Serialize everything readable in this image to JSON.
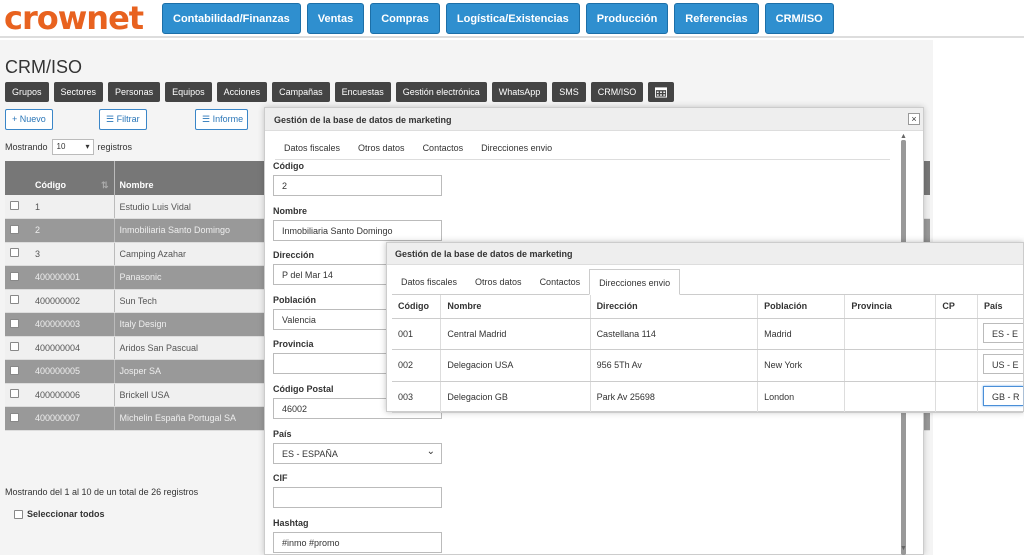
{
  "logo": "crownet",
  "topnav": [
    "Contabilidad/Finanzas",
    "Ventas",
    "Compras",
    "Logística/Existencias",
    "Producción",
    "Referencias",
    "CRM/ISO"
  ],
  "page_title": "CRM/ISO",
  "subnav": [
    "Grupos",
    "Sectores",
    "Personas",
    "Equipos",
    "Acciones",
    "Campañas",
    "Encuestas",
    "Gestión electrónica",
    "WhatsApp",
    "SMS",
    "CRM/ISO"
  ],
  "toolbar": {
    "nuevo": "+ Nuevo",
    "filtrar": "Filtrar",
    "informe": "Informe"
  },
  "show": {
    "prefix": "Mostrando",
    "value": "10",
    "suffix": "registros"
  },
  "list": {
    "headers": [
      "Código",
      "Nombre"
    ],
    "rows": [
      {
        "codigo": "1",
        "nombre": "Estudio Luis Vidal"
      },
      {
        "codigo": "2",
        "nombre": "Inmobiliaria Santo Domingo"
      },
      {
        "codigo": "3",
        "nombre": "Camping Azahar"
      },
      {
        "codigo": "400000001",
        "nombre": "Panasonic"
      },
      {
        "codigo": "400000002",
        "nombre": "Sun Tech"
      },
      {
        "codigo": "400000003",
        "nombre": "Italy Design"
      },
      {
        "codigo": "400000004",
        "nombre": "Aridos San Pascual"
      },
      {
        "codigo": "400000005",
        "nombre": "Josper SA"
      },
      {
        "codigo": "400000006",
        "nombre": "Brickell USA"
      },
      {
        "codigo": "400000007",
        "nombre": "Michelin España Portugal SA"
      }
    ]
  },
  "footer": {
    "summary": "Mostrando del 1 al 10 de un total de 26 registros",
    "select_all": "Seleccionar todos"
  },
  "modal1": {
    "title": "Gestión de la base de datos de marketing",
    "tabs": [
      "Datos fiscales",
      "Otros datos",
      "Contactos",
      "Direcciones envio"
    ],
    "fields": {
      "codigo": {
        "label": "Código",
        "value": "2"
      },
      "nombre": {
        "label": "Nombre",
        "value": "Inmobiliaria Santo Domingo"
      },
      "direccion": {
        "label": "Dirección",
        "value": "P del Mar 14"
      },
      "poblacion": {
        "label": "Población",
        "value": "Valencia"
      },
      "provincia": {
        "label": "Provincia",
        "value": ""
      },
      "cp": {
        "label": "Código Postal",
        "value": "46002"
      },
      "pais": {
        "label": "País",
        "value": "ES - ESPAÑA"
      },
      "cif": {
        "label": "CIF",
        "value": ""
      },
      "hashtag": {
        "label": "Hashtag",
        "value": "#inmo #promo"
      }
    }
  },
  "modal2": {
    "title": "Gestión de la base de datos de marketing",
    "tabs": [
      "Datos fiscales",
      "Otros datos",
      "Contactos",
      "Direcciones envio"
    ],
    "headers": [
      "Código",
      "Nombre",
      "Dirección",
      "Población",
      "Provincia",
      "CP",
      "País"
    ],
    "rows": [
      {
        "codigo": "001",
        "nombre": "Central Madrid",
        "direccion": "Castellana 114",
        "poblacion": "Madrid",
        "provincia": "",
        "cp": "",
        "pais": "ES - E"
      },
      {
        "codigo": "002",
        "nombre": "Delegacion USA",
        "direccion": "956 5Th Av",
        "poblacion": "New York",
        "provincia": "",
        "cp": "",
        "pais": "US - E"
      },
      {
        "codigo": "003",
        "nombre": "Delegacion GB",
        "direccion": "Park Av 25698",
        "poblacion": "London",
        "provincia": "",
        "cp": "",
        "pais": "GB - R"
      }
    ]
  }
}
